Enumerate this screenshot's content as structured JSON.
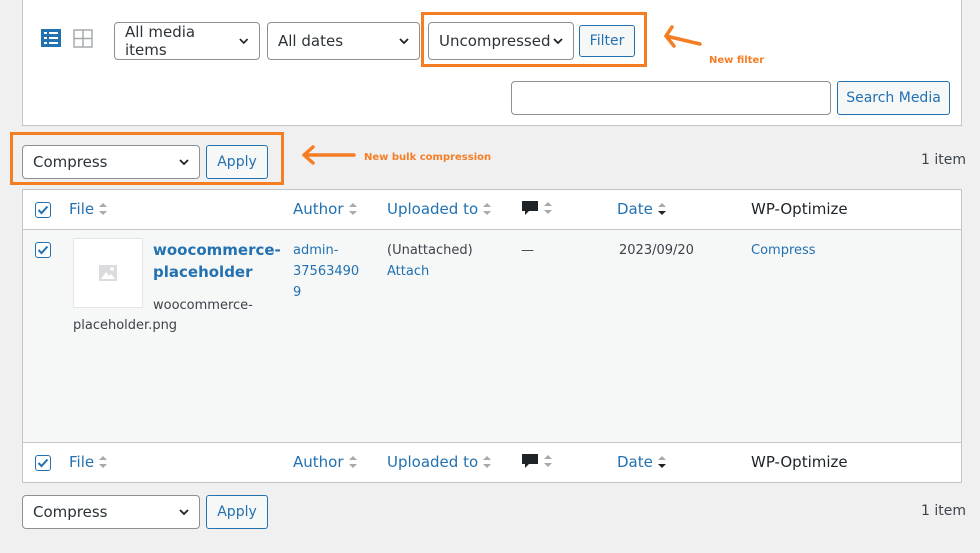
{
  "filters": {
    "media_type": "All media items",
    "dates": "All dates",
    "compression": "Uncompressed",
    "filter_button": "Filter",
    "search_button": "Search Media",
    "search_value": ""
  },
  "annotations": {
    "new_filter": "New filter",
    "new_bulk": "New bulk compression"
  },
  "bulk_top": {
    "action": "Compress",
    "apply": "Apply",
    "count": "1 item"
  },
  "bulk_bottom": {
    "action": "Compress",
    "apply": "Apply",
    "count": "1 item"
  },
  "table": {
    "columns": {
      "file": "File",
      "author": "Author",
      "uploaded_to": "Uploaded to",
      "date": "Date",
      "wp_optimize": "WP-Optimize"
    },
    "rows": [
      {
        "title_line1": "woocommerce-",
        "title_line2": "placeholder",
        "filename_line1": "woocommerce-",
        "filename_line2": "placeholder.png",
        "author_line1": "admin-",
        "author_line2": "37563490",
        "author_line3": "9",
        "uploaded_line1": "(Unattached)",
        "uploaded_attach": "Attach",
        "comments": "—",
        "date": "2023/09/20",
        "wp_optimize": "Compress"
      }
    ]
  },
  "colors": {
    "accent": "#2271b1",
    "highlight": "#f57e25"
  }
}
